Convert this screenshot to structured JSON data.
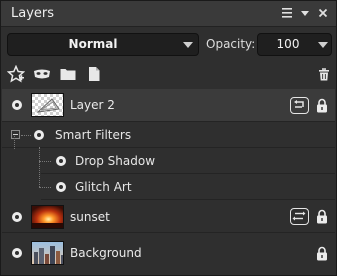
{
  "panel": {
    "title": "Layers",
    "menu_icon": "menu-icon",
    "collapse_icon": "triangle-down-icon",
    "close_icon": "close-icon"
  },
  "blend_mode": {
    "value": "Normal"
  },
  "opacity": {
    "label": "Opacity:",
    "value": "100"
  },
  "toolbar": [
    "star-add-icon",
    "mask-icon",
    "folder-icon",
    "new-document-icon",
    "trash-icon"
  ],
  "layers": [
    {
      "name": "Layer 2",
      "selected": true,
      "thumb": "transparent-shape"
    },
    {
      "name": "sunset",
      "selected": false,
      "thumb": "sunset-photo"
    },
    {
      "name": "Background",
      "selected": false,
      "thumb": "city-photo"
    }
  ],
  "smart_filters": {
    "label": "Smart Filters",
    "items": [
      {
        "name": "Drop Shadow"
      },
      {
        "name": "Glitch Art"
      }
    ]
  }
}
